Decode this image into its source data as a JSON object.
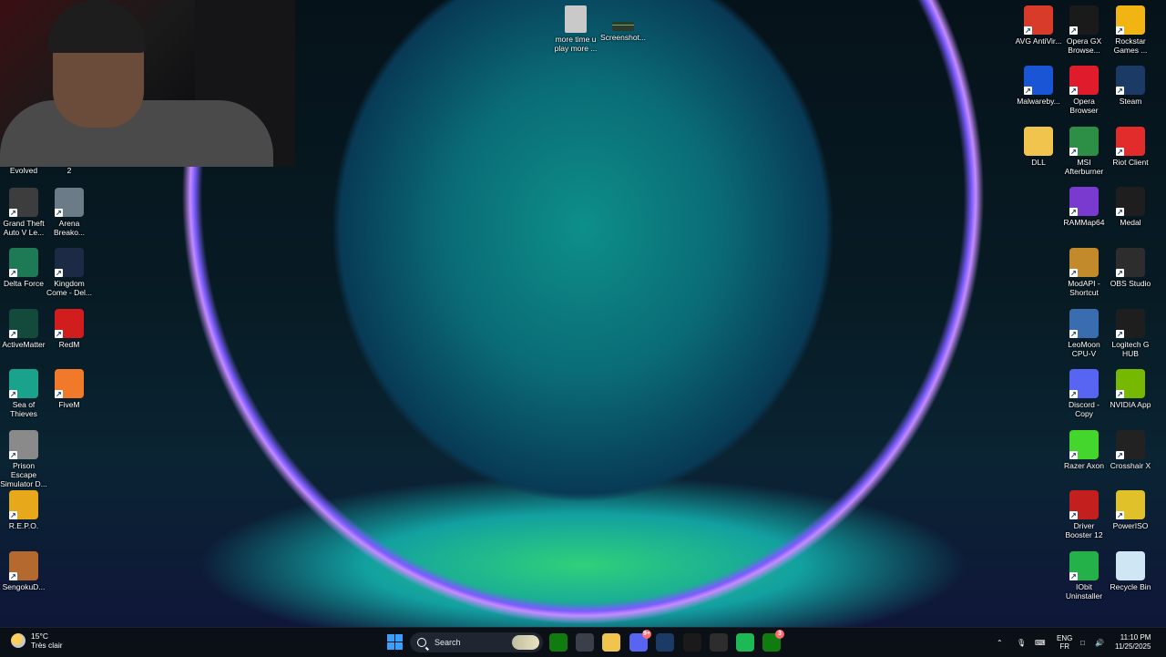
{
  "desktop": {
    "top_files": [
      {
        "label": "more time u play more ...",
        "icon": "image-file-icon"
      },
      {
        "label": "Screenshot...",
        "icon": "screenshot-file-icon"
      }
    ],
    "webcam_labels": [
      "Evolved",
      "2"
    ],
    "left_icons": [
      {
        "label": "Grand Theft Auto V Le...",
        "icon": "gta-icon",
        "color": "#3d3d3d"
      },
      {
        "label": "Arena Breako...",
        "icon": "arena-breakout-icon",
        "color": "#6b7b88"
      },
      {
        "label": "Delta Force",
        "icon": "delta-force-icon",
        "color": "#1d7a55"
      },
      {
        "label": "Kingdom Come - Del...",
        "icon": "kingdom-come-icon",
        "color": "#1d2a45"
      },
      {
        "label": "ActiveMatter",
        "icon": "activematter-icon",
        "color": "#134a3c"
      },
      {
        "label": "RedM",
        "icon": "redm-icon",
        "color": "#d11d1d"
      },
      {
        "label": "Sea of Thieves",
        "icon": "sea-of-thieves-icon",
        "color": "#1aa38c"
      },
      {
        "label": "FiveM",
        "icon": "fivem-icon",
        "color": "#f07a2a"
      },
      {
        "label": "Prison Escape Simulator D...",
        "icon": "prison-escape-icon",
        "color": "#8a8a8a"
      },
      {
        "label": "R.E.P.O.",
        "icon": "repo-icon",
        "color": "#e7a91b"
      },
      {
        "label": "SengokuD...",
        "icon": "sengoku-icon",
        "color": "#b46a2e"
      }
    ],
    "right_icons": [
      {
        "label": "AVG AntiVir...",
        "icon": "avg-icon",
        "color": "#d93b2b"
      },
      {
        "label": "Opera GX Browse...",
        "icon": "opera-gx-icon",
        "color": "#1a1a1a"
      },
      {
        "label": "Rockstar Games ...",
        "icon": "rockstar-icon",
        "color": "#f2b413"
      },
      {
        "label": "Malwareby...",
        "icon": "malwarebytes-icon",
        "color": "#1a55d6"
      },
      {
        "label": "Opera Browser",
        "icon": "opera-icon",
        "color": "#e01b2b"
      },
      {
        "label": "Steam",
        "icon": "steam-icon",
        "color": "#1b3a66"
      },
      {
        "label": "DLL",
        "icon": "folder-icon",
        "color": "#f1c54d"
      },
      {
        "label": "MSI Afterburner",
        "icon": "msi-afterburner-icon",
        "color": "#2d8f46"
      },
      {
        "label": "Riot Client",
        "icon": "riot-client-icon",
        "color": "#e22b2b"
      },
      {
        "label": "RAMMap64",
        "icon": "rammap-icon",
        "color": "#7a3ad0"
      },
      {
        "label": "Medal",
        "icon": "medal-icon",
        "color": "#1e1e1e"
      },
      {
        "label": "ModAPI - Shortcut",
        "icon": "modapi-icon",
        "color": "#c28a2a"
      },
      {
        "label": "OBS Studio",
        "icon": "obs-icon",
        "color": "#2d2d2d"
      },
      {
        "label": "LeoMoon CPU-V",
        "icon": "cpu-icon",
        "color": "#3a6db0"
      },
      {
        "label": "Logitech G HUB",
        "icon": "logitech-icon",
        "color": "#1e1e1e"
      },
      {
        "label": "Discord - Copy",
        "icon": "discord-icon",
        "color": "#5865f2"
      },
      {
        "label": "NVIDIA App",
        "icon": "nvidia-icon",
        "color": "#76b900"
      },
      {
        "label": "Razer Axon",
        "icon": "razer-axon-icon",
        "color": "#44d62c"
      },
      {
        "label": "Crosshair X",
        "icon": "crosshair-icon",
        "color": "#222"
      },
      {
        "label": "Driver Booster 12",
        "icon": "driver-booster-icon",
        "color": "#c41f1f"
      },
      {
        "label": "PowerISO",
        "icon": "poweriso-icon",
        "color": "#e1c12a"
      },
      {
        "label": "IObit Uninstaller",
        "icon": "iobit-uninstaller-icon",
        "color": "#24b14a"
      },
      {
        "label": "Recycle Bin",
        "icon": "recycle-bin-icon",
        "color": "#cfe6f5"
      }
    ]
  },
  "taskbar": {
    "weather": {
      "temp": "15°C",
      "desc": "Très clair"
    },
    "search": {
      "placeholder": "Search"
    },
    "apps": [
      {
        "name": "xbox-icon",
        "color": "#107c10",
        "badge": ""
      },
      {
        "name": "app-icon",
        "color": "#3a3f4a",
        "badge": ""
      },
      {
        "name": "file-explorer-icon",
        "color": "#f1c54d",
        "badge": ""
      },
      {
        "name": "discord-icon",
        "color": "#5865f2",
        "badge": "9+"
      },
      {
        "name": "steam-icon",
        "color": "#1b3a66",
        "badge": ""
      },
      {
        "name": "opera-gx-icon",
        "color": "#1a1a1a",
        "badge": ""
      },
      {
        "name": "obs-icon",
        "color": "#2d2d2d",
        "badge": ""
      },
      {
        "name": "spotify-icon",
        "color": "#1db954",
        "badge": ""
      },
      {
        "name": "xbox-app-icon",
        "color": "#107c10",
        "badge": "3"
      }
    ],
    "tray": {
      "lang_top": "ENG",
      "lang_bottom": "FR",
      "time": "11:10 PM",
      "date": "11/25/2025"
    }
  }
}
